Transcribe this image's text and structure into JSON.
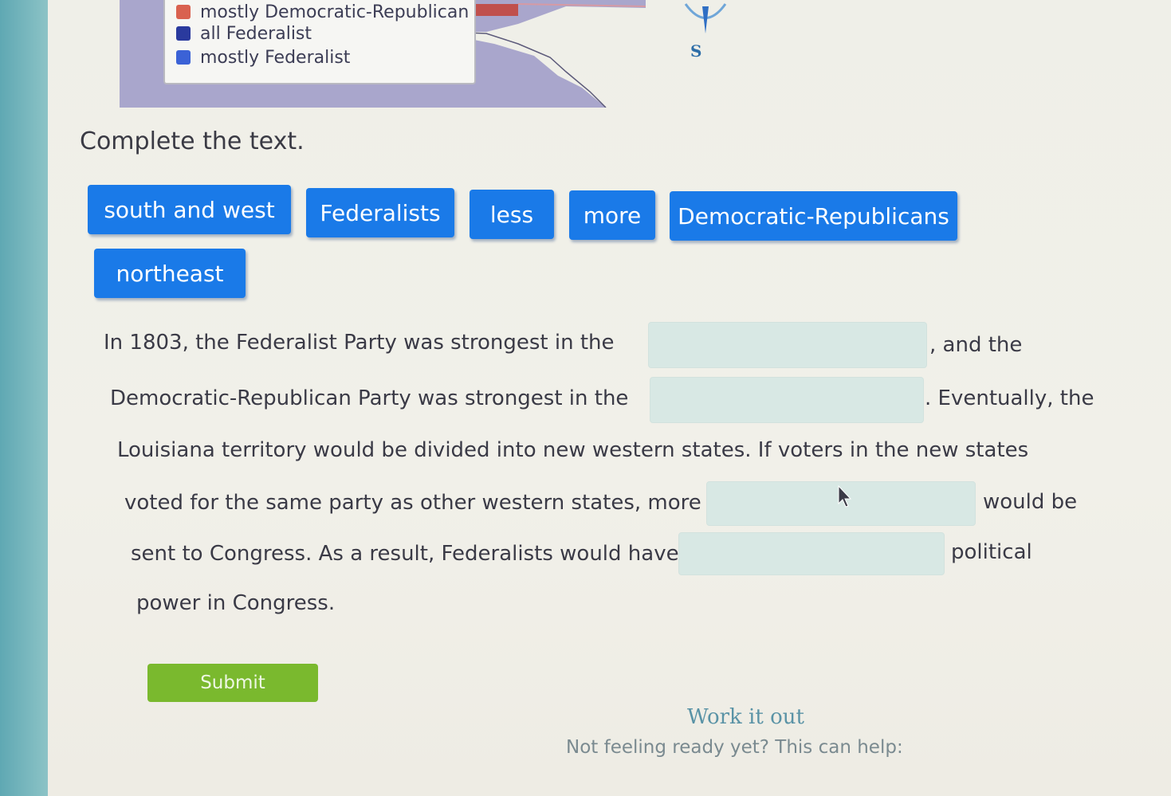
{
  "legend": {
    "items": [
      {
        "label": "mostly Democratic-Republican",
        "color": "#d9614f"
      },
      {
        "label": "all Federalist",
        "color": "#2a3a9e"
      },
      {
        "label": "mostly Federalist",
        "color": "#3b62d6"
      }
    ]
  },
  "compass": {
    "direction": "S"
  },
  "instruction": "Complete the text.",
  "word_bank": [
    "south and west",
    "Federalists",
    "less",
    "more",
    "Democratic-Republicans",
    "northeast"
  ],
  "passage": {
    "line1_a": "In 1803, the Federalist Party was strongest in the",
    "line1_b": ", and the",
    "line2_a": "Democratic-Republican Party was strongest in the",
    "line2_b": ". Eventually, the",
    "line3": "Louisiana territory would be divided into new western states. If voters in the new states",
    "line4_a": "voted for the same party as other western states, more",
    "line4_b": "would be",
    "line5_a": "sent to Congress. As a result, Federalists would have",
    "line5_b": "political",
    "line6": "power in Congress."
  },
  "submit_label": "Submit",
  "help": {
    "work_it_out": "Work it out",
    "not_ready": "Not feeling ready yet? This can help:"
  },
  "colors": {
    "tile_blue": "#1a7ae8",
    "submit_green": "#7ab92e",
    "blank_fill": "#d8e8e4"
  }
}
